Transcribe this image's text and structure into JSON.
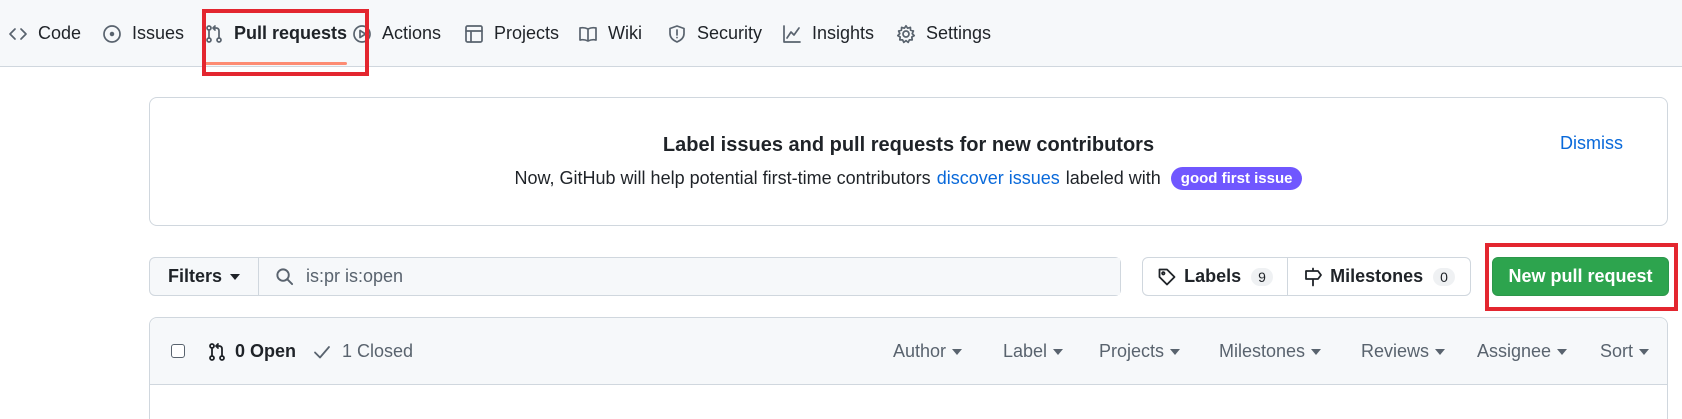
{
  "repo_nav": {
    "items": [
      {
        "label": "Code",
        "icon": "code-icon"
      },
      {
        "label": "Issues",
        "icon": "issue-opened-icon"
      },
      {
        "label": "Pull requests",
        "icon": "git-pull-request-icon",
        "selected": true
      },
      {
        "label": "Actions",
        "icon": "play-icon"
      },
      {
        "label": "Projects",
        "icon": "table-icon"
      },
      {
        "label": "Wiki",
        "icon": "book-icon"
      },
      {
        "label": "Security",
        "icon": "shield-icon"
      },
      {
        "label": "Insights",
        "icon": "graph-icon"
      },
      {
        "label": "Settings",
        "icon": "gear-icon"
      }
    ]
  },
  "banner": {
    "title": "Label issues and pull requests for new contributors",
    "text_prefix": "Now, GitHub will help potential first-time contributors",
    "link_text": "discover issues",
    "text_suffix": "labeled with",
    "badge": "good first issue",
    "dismiss": "Dismiss"
  },
  "filters": {
    "button_label": "Filters",
    "search_value": "is:pr is:open"
  },
  "labels_button": {
    "label": "Labels",
    "count": "9"
  },
  "milestones_button": {
    "label": "Milestones",
    "count": "0"
  },
  "new_pr_button": {
    "label": "New pull request"
  },
  "list_header": {
    "open_label": "0 Open",
    "closed_label": "1 Closed",
    "menus": [
      "Author",
      "Label",
      "Projects",
      "Milestones",
      "Reviews",
      "Assignee",
      "Sort"
    ]
  },
  "colors": {
    "accent_underline": "#fd8c73",
    "primary_button": "#2da44e",
    "link": "#0969da",
    "badge": "#7057ff",
    "annotation": "#e3262f"
  }
}
